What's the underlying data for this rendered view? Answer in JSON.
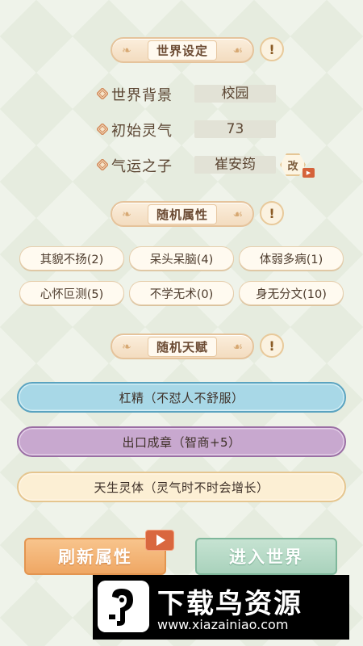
{
  "sections": {
    "world": {
      "title": "世界设定",
      "info": "!"
    },
    "attributes": {
      "title": "随机属性",
      "info": "!"
    },
    "talents": {
      "title": "随机天赋",
      "info": "!"
    }
  },
  "world_settings": [
    {
      "label": "世界背景",
      "value": "校园"
    },
    {
      "label": "初始灵气",
      "value": "73"
    },
    {
      "label": "气运之子",
      "value": "崔安筠"
    }
  ],
  "change_button": {
    "label": "改"
  },
  "attributes": [
    "其貌不扬(2)",
    "呆头呆脑(4)",
    "体弱多病(1)",
    "心怀叵测(5)",
    "不学无术(0)",
    "身无分文(10)"
  ],
  "talents": [
    {
      "text": "杠精（不怼人不舒服）",
      "color": "#a8d8e7"
    },
    {
      "text": "出口成章（智商+5）",
      "color": "#c8a8cf"
    },
    {
      "text": "天生灵体（灵气时不时会增长）",
      "color": "#fcefd4"
    }
  ],
  "buttons": {
    "refresh": "刷新属性",
    "enter": "进入世界"
  },
  "watermark": {
    "title": "下载鸟资源",
    "url": "www.xiazainiao.com"
  }
}
